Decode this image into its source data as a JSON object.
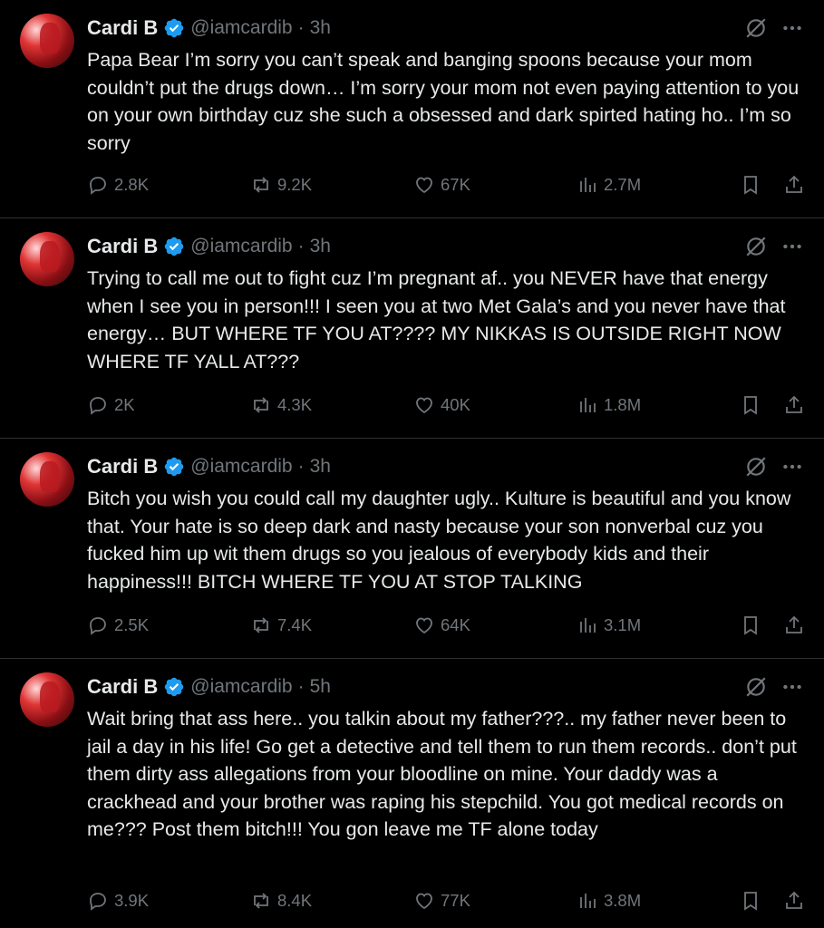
{
  "tweets": [
    {
      "author": "Cardi B",
      "handle": "@iamcardib",
      "time": "3h",
      "text": "Papa Bear I’m sorry you can’t speak and banging spoons because your mom couldn’t put the drugs down… I’m sorry your mom not even paying attention to you on your own birthday cuz she such a obsessed and dark spirted hating ho.. I’m so sorry",
      "replies": "2.8K",
      "reposts": "9.2K",
      "likes": "67K",
      "views": "2.7M"
    },
    {
      "author": "Cardi B",
      "handle": "@iamcardib",
      "time": "3h",
      "text": "Trying to call me out to fight cuz I’m pregnant af.. you NEVER have that energy when I see you in person!!! I seen you at two Met Gala’s and you never have that energy… BUT WHERE TF YOU AT???? MY NIKKAS IS OUTSIDE RIGHT NOW WHERE TF YALL AT???",
      "replies": "2K",
      "reposts": "4.3K",
      "likes": "40K",
      "views": "1.8M"
    },
    {
      "author": "Cardi B",
      "handle": "@iamcardib",
      "time": "3h",
      "text": "Bitch you wish you could call my daughter ugly.. Kulture is beautiful and you know that. Your hate is so deep dark and nasty because your son nonverbal cuz you fucked him up wit them drugs so you jealous of everybody kids and their happiness!!! BITCH WHERE TF YOU AT STOP TALKING",
      "replies": "2.5K",
      "reposts": "7.4K",
      "likes": "64K",
      "views": "3.1M"
    },
    {
      "author": "Cardi B",
      "handle": "@iamcardib",
      "time": "5h",
      "text": "Wait bring that ass here.. you talkin about my father???.. my father never been to jail a day in his life! Go get a detective and tell them to run them records.. don’t put them dirty ass allegations from your bloodline on mine. Your daddy was a crackhead and your brother was raping his stepchild. You got medical records on me??? Post them bitch!!! You gon leave me TF alone today",
      "replies": "3.9K",
      "reposts": "8.4K",
      "likes": "77K",
      "views": "3.8M"
    }
  ],
  "icons": {
    "verified": "verified-badge-icon",
    "grok": "grok-icon",
    "more": "more-icon",
    "reply": "reply-icon",
    "repost": "repost-icon",
    "like": "like-icon",
    "views": "views-icon",
    "bookmark": "bookmark-icon",
    "share": "share-icon"
  },
  "colors": {
    "background": "#000000",
    "text": "#e7e9ea",
    "muted": "#71767b",
    "divider": "#2f3336",
    "verified": "#1d9bf0"
  }
}
